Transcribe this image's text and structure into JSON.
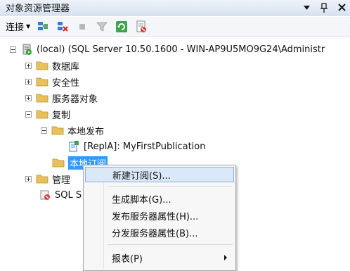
{
  "window": {
    "title": "对象资源管理器",
    "controls": [
      "▾",
      "ㄗ",
      "✕"
    ]
  },
  "toolbar": {
    "connect_label": "连接",
    "icons": [
      "connect-object-explorer-icon",
      "disconnect-icon",
      "stop-icon",
      "filter-icon",
      "refresh-icon",
      "policy-icon"
    ]
  },
  "tree": {
    "server": {
      "label": "(local) (SQL Server 10.50.1600 - WIN-AP9U5MO9G24\\Administr"
    },
    "databases": {
      "label": "数据库"
    },
    "security": {
      "label": "安全性"
    },
    "server_objects": {
      "label": "服务器对象"
    },
    "replication": {
      "label": "复制"
    },
    "local_publications": {
      "label": "本地发布"
    },
    "publication": {
      "label": "[ReplA]: MyFirstPublication"
    },
    "local_subscriptions": {
      "label": "本地订阅"
    },
    "management": {
      "label": "管理"
    },
    "sql_server_agent": {
      "label": "SQL S"
    }
  },
  "context_menu": {
    "items": [
      {
        "label": "新建订阅(S)...",
        "highlighted": true
      },
      {
        "label": "生成脚本(G)..."
      },
      {
        "label": "发布服务器属性(H)..."
      },
      {
        "label": "分发服务器属性(B)..."
      },
      {
        "label": "报表(P)",
        "has_submenu": true
      }
    ]
  },
  "colors": {
    "selection": "#3399ff",
    "menu_hover": "#dbe8f7",
    "folder": "#e8c15a"
  }
}
